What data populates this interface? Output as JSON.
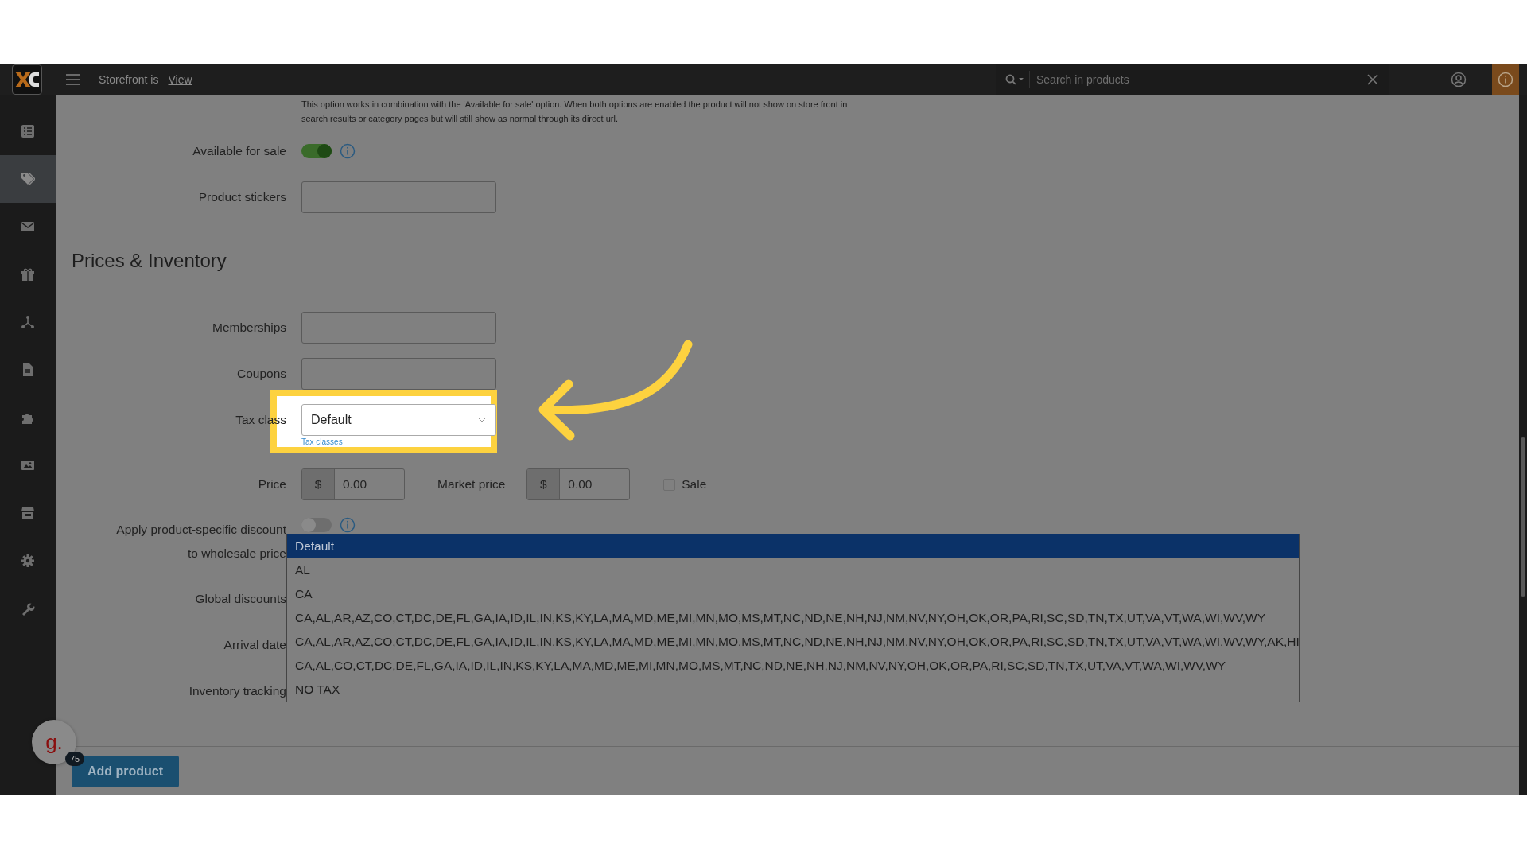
{
  "topbar": {
    "storefront_label": "Storefront is",
    "view_link": "View",
    "search": {
      "placeholder": "Search in products"
    }
  },
  "sidebar": {
    "items": [
      {
        "kind": "list",
        "selected": false
      },
      {
        "kind": "tag",
        "selected": true
      },
      {
        "kind": "mail",
        "selected": false
      },
      {
        "kind": "gift",
        "selected": false
      },
      {
        "kind": "nodes",
        "selected": false
      },
      {
        "kind": "document",
        "selected": false
      },
      {
        "kind": "puzzle",
        "selected": false
      },
      {
        "kind": "image",
        "selected": false
      },
      {
        "kind": "store",
        "selected": false
      },
      {
        "kind": "gear",
        "selected": false
      },
      {
        "kind": "wrench",
        "selected": false
      }
    ]
  },
  "notice": {
    "lines": [
      "This option works in combination with the 'Available for sale' option. When both options are enabled the product will not show on store front in",
      "search results or category pages but will still show as normal through its direct url."
    ]
  },
  "section1": [
    {
      "kind": "toggle",
      "label": "Available for sale",
      "on": true
    },
    {
      "kind": "text",
      "label": "Product stickers"
    }
  ],
  "heading": "Prices & Inventory",
  "section2": [
    {
      "kind": "text",
      "label": "Memberships"
    },
    {
      "kind": "text",
      "label": "Coupons"
    },
    {
      "kind": "select",
      "label": "Tax class",
      "value": "Default",
      "link": "Tax classes"
    },
    {
      "kind": "price",
      "label": "Price",
      "currency": "$",
      "value": "0.00",
      "market_label": "Market price",
      "market_currency": "$",
      "market_value": "0.00",
      "sale_label": "Sale",
      "sale_checked": false
    },
    {
      "kind": "toggle",
      "label": "Apply product-specific discount to wholesale price",
      "on": false
    },
    {
      "kind": "plain",
      "label": "Global discounts"
    },
    {
      "kind": "plain",
      "label": "Arrival date"
    },
    {
      "kind": "plain",
      "label": "Inventory tracking"
    }
  ],
  "tax_dropdown": {
    "options": [
      {
        "label": "Default",
        "selected": true
      },
      {
        "label": "AL",
        "selected": false
      },
      {
        "label": "CA",
        "selected": false
      },
      {
        "label": "CA,AL,AR,AZ,CO,CT,DC,DE,FL,GA,IA,ID,IL,IN,KS,KY,LA,MA,MD,ME,MI,MN,MO,MS,MT,NC,ND,NE,NH,NJ,NM,NV,NY,OH,OK,OR,PA,RI,SC,SD,TN,TX,UT,VA,VT,WA,WI,WV,WY",
        "selected": false
      },
      {
        "label": "CA,AL,AR,AZ,CO,CT,DC,DE,FL,GA,IA,ID,IL,IN,KS,KY,LA,MA,MD,ME,MI,MN,MO,MS,MT,NC,ND,NE,NH,NJ,NM,NV,NY,OH,OK,OR,PA,RI,SC,SD,TN,TX,UT,VA,VT,WA,WI,WV,WY,AK,HI",
        "selected": false
      },
      {
        "label": "CA,AL,CO,CT,DC,DE,FL,GA,IA,ID,IL,IN,KS,KY,LA,MA,MD,ME,MI,MN,MO,MS,MT,NC,ND,NE,NH,NJ,NM,NV,NY,OH,OK,OR,PA,RI,SC,SD,TN,TX,UT,VA,VT,WA,WI,WV,WY",
        "selected": false
      },
      {
        "label": "NO TAX",
        "selected": false
      }
    ]
  },
  "footer": {
    "add_button": "Add product",
    "avatar_letter": "g.",
    "badge": "75"
  }
}
